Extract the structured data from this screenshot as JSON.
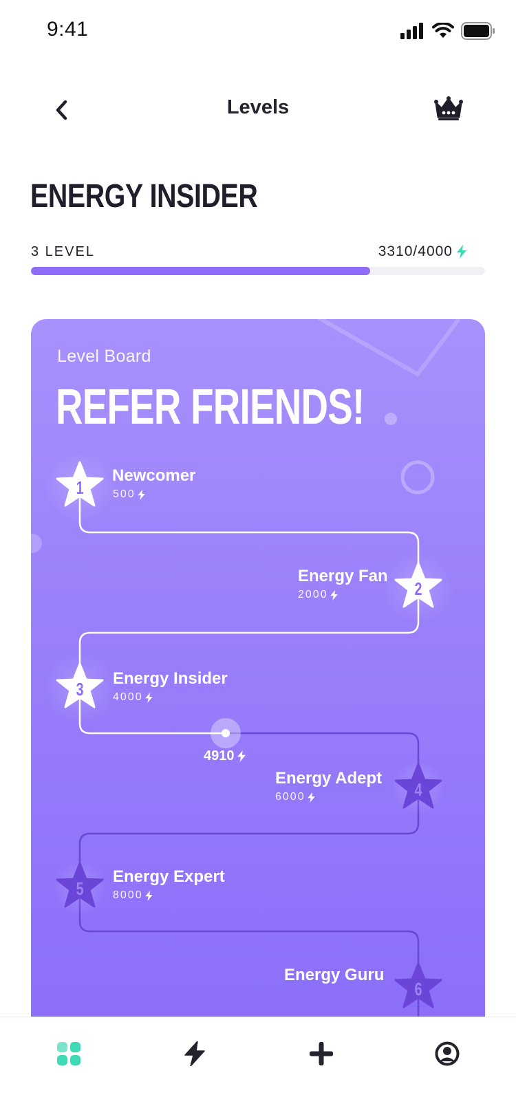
{
  "status_bar": {
    "time": "9:41",
    "icons": [
      "signal-icon",
      "wifi-icon",
      "battery-icon"
    ]
  },
  "nav": {
    "title": "Levels",
    "back_icon": "chevron-left-icon",
    "crown_icon": "crown-icon"
  },
  "level": {
    "title": "ENERGY INSIDER",
    "label": "3 LEVEL",
    "points": "3310/4000",
    "progress_fraction": 0.7475,
    "accent": "#8f6bf8",
    "bolt_color": "#3fd9b5"
  },
  "board": {
    "label": "Level Board",
    "heading": "REFER FRIENDS!",
    "levels": [
      {
        "num": "1",
        "name": "Newcomer",
        "points": "500",
        "reached": true
      },
      {
        "num": "2",
        "name": "Energy Fan",
        "points": "2000",
        "reached": true
      },
      {
        "num": "3",
        "name": "Energy Insider",
        "points": "4000",
        "reached": true
      },
      {
        "num": "4",
        "name": "Energy Adept",
        "points": "6000",
        "reached": false
      },
      {
        "num": "5",
        "name": "Energy Expert",
        "points": "8000",
        "reached": false
      },
      {
        "num": "6",
        "name": "Energy Guru",
        "points": "",
        "reached": false
      }
    ],
    "cursor_points": "4910"
  },
  "tabbar": {
    "tabs": [
      {
        "name": "tab-dashboard",
        "icon": "dashboard-icon",
        "active": true
      },
      {
        "name": "tab-energy",
        "icon": "lightning-icon",
        "active": false
      },
      {
        "name": "tab-add",
        "icon": "plus-icon",
        "active": false
      },
      {
        "name": "tab-profile",
        "icon": "user-circle-icon",
        "active": false
      }
    ]
  }
}
